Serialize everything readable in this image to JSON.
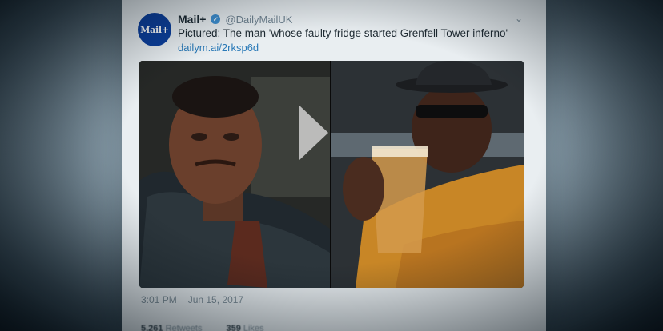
{
  "tweet": {
    "display_name": "Mail+",
    "handle": "@DailyMailUK",
    "avatar_text": "Mail+",
    "text": "Pictured: The man 'whose faulty fridge started Grenfell Tower inferno'",
    "link": "dailym.ai/2rksp6d",
    "time": "3:01 PM",
    "date": "Jun 15, 2017"
  },
  "stats": {
    "retweets_count": "5,261",
    "retweets_label": "Retweets",
    "likes_count": "359",
    "likes_label": "Likes"
  },
  "icons": {
    "verified": "verified-check-icon",
    "caret": "chevron-down-icon",
    "play": "play-icon"
  },
  "colors": {
    "link": "#2a7ab8",
    "avatar_bg": "#0b3f9e",
    "verified": "#3d8fd1"
  }
}
